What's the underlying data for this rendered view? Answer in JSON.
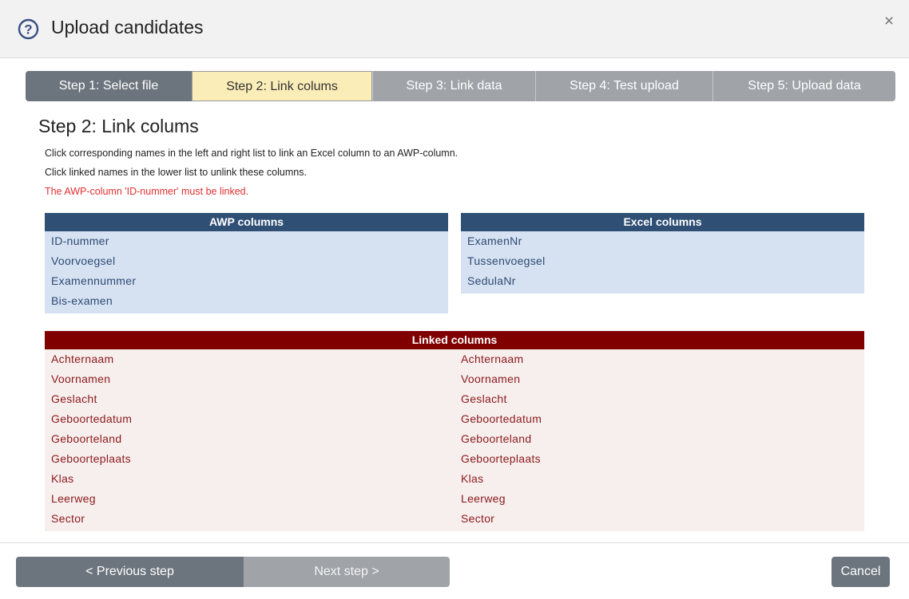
{
  "dialog": {
    "title": "Upload candidates",
    "close_label": "×",
    "help_icon": "question-circle-icon"
  },
  "steps": [
    {
      "label": "Step 1: Select file",
      "state": "completed"
    },
    {
      "label": "Step 2: Link colums",
      "state": "active"
    },
    {
      "label": "Step 3: Link data",
      "state": "pending"
    },
    {
      "label": "Step 4: Test upload",
      "state": "pending"
    },
    {
      "label": "Step 5: Upload data",
      "state": "pending"
    }
  ],
  "content": {
    "heading": "Step 2: Link colums",
    "info_lines": [
      "Click corresponding names in the left and right list to link an Excel column to an AWP-column.",
      "Click linked names in the lower list to unlink these columns."
    ],
    "warning": "The AWP-column 'ID-nummer' must be linked."
  },
  "awp_columns": {
    "header": "AWP columns",
    "items": [
      "ID-nummer",
      "Voorvoegsel",
      "Examennummer",
      "Bis-examen"
    ]
  },
  "excel_columns": {
    "header": "Excel columns",
    "items": [
      "ExamenNr",
      "Tussenvoegsel",
      "SedulaNr"
    ]
  },
  "linked_columns": {
    "header": "Linked columns",
    "rows": [
      {
        "awp": "Achternaam",
        "excel": "Achternaam"
      },
      {
        "awp": "Voornamen",
        "excel": "Voornamen"
      },
      {
        "awp": "Geslacht",
        "excel": "Geslacht"
      },
      {
        "awp": "Geboortedatum",
        "excel": "Geboortedatum"
      },
      {
        "awp": "Geboorteland",
        "excel": "Geboorteland"
      },
      {
        "awp": "Geboorteplaats",
        "excel": "Geboorteplaats"
      },
      {
        "awp": "Klas",
        "excel": "Klas"
      },
      {
        "awp": "Leerweg",
        "excel": "Leerweg"
      },
      {
        "awp": "Sector",
        "excel": "Sector"
      }
    ]
  },
  "footer": {
    "prev_label": "< Previous step",
    "next_label": "Next step >",
    "cancel_label": "Cancel"
  },
  "colors": {
    "step_active": "#faedb8",
    "list_header": "#2f4f75",
    "linked_header": "#800000",
    "warning": "#e03030"
  }
}
